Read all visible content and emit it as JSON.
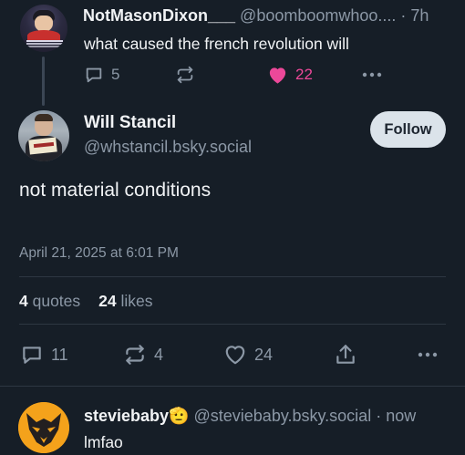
{
  "parent_post": {
    "display_name": "NotMasonDixon___",
    "handle": "@boomboomwhoo....",
    "separator": " · ",
    "time": "7h",
    "text": "what caused the french revolution will",
    "reply_count": "5",
    "like_count": "22",
    "liked": true
  },
  "main_post": {
    "display_name": "Will Stancil",
    "handle": "@whstancil.bsky.social",
    "follow_label": "Follow",
    "text": "not material conditions",
    "timestamp": "April 21, 2025 at 6:01 PM",
    "quotes_count": "4",
    "quotes_label": "quotes",
    "likes_count": "24",
    "likes_label": "likes",
    "reply_count": "11",
    "repost_count": "4",
    "like_count": "24"
  },
  "reply_post": {
    "display_name": "steviebaby",
    "emoji": "🫡",
    "handle": "@steviebaby.bsky.social",
    "separator": " · ",
    "time": "now",
    "text": "lmfao"
  },
  "colors": {
    "background": "#161e27",
    "text_primary": "#f1f3f5",
    "text_secondary": "#8c98a6",
    "like_pink": "#ec4899",
    "follow_button_bg": "#dbe3ea",
    "wolf_orange": "#f4a21b"
  },
  "icons": [
    "reply-icon",
    "repost-icon",
    "heart-icon",
    "more-icon",
    "share-icon"
  ]
}
